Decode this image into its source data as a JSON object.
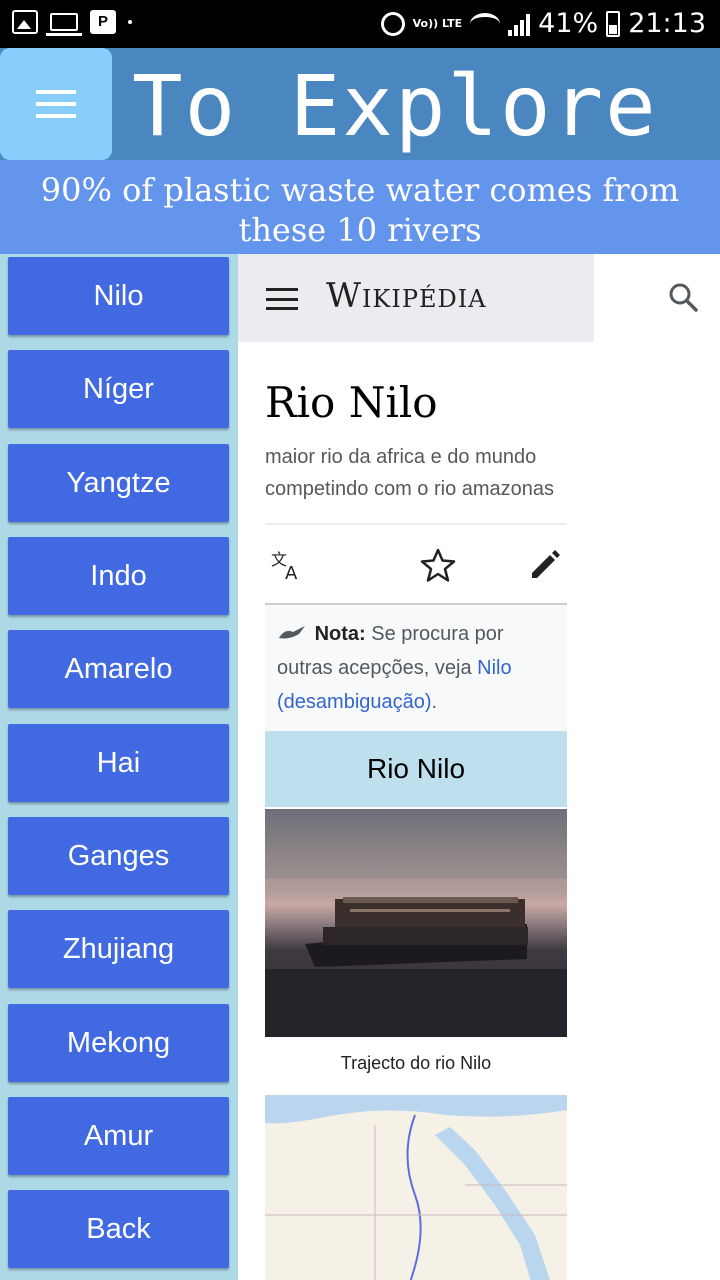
{
  "status_bar": {
    "volte": "Vo)) LTE",
    "battery": "41%",
    "time": "21:13"
  },
  "header": {
    "title": "To Explore",
    "subtitle": "90% of plastic waste water comes from these 10 rivers"
  },
  "rivers": [
    "Nilo",
    "Níger",
    "Yangtze",
    "Indo",
    "Amarelo",
    "Hai",
    "Ganges",
    "Zhujiang",
    "Mekong",
    "Amur"
  ],
  "back_label": "Back",
  "wiki": {
    "logo": "Wikipédia",
    "title": "Rio Nilo",
    "description": "maior rio da africa e do mundo competindo com o rio amazonas",
    "note_bold": "Nota:",
    "note_text": " Se procura por outras acepções, veja ",
    "note_link": "Nilo (desambiguação)",
    "note_end": ".",
    "infobox_title": "Rio Nilo",
    "caption": "Trajecto do rio Nilo"
  },
  "colors": {
    "header": "#4a86c0",
    "menu_button": "#87cefa",
    "subtitle": "#6495ed",
    "side_panel": "#add8e6",
    "river_button": "#4169e1"
  }
}
